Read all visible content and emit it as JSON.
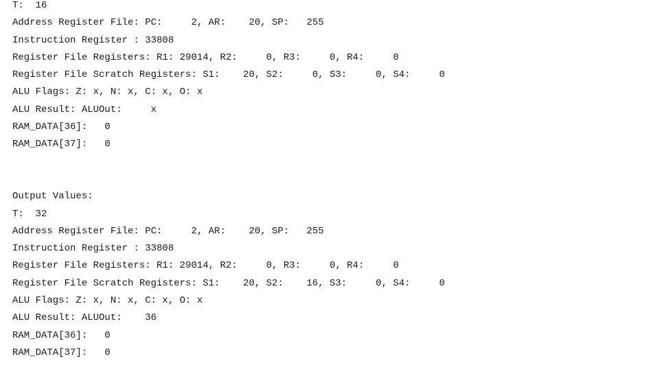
{
  "console": {
    "block1": {
      "lines": [
        "T:  16",
        "Address Register File: PC:     2, AR:    20, SP:   255",
        "Instruction Register : 33808",
        "Register File Registers: R1: 29014, R2:     0, R3:     0, R4:     0",
        "Register File Scratch Registers: S1:    20, S2:     0, S3:     0, S4:     0",
        "ALU Flags: Z: x, N: x, C: x, O: x",
        "ALU Result: ALUOut:     x",
        "RAM_DATA[36]:   0",
        "RAM_DATA[37]:   0"
      ]
    },
    "block2": {
      "header": "Output Values:",
      "lines": [
        "T:  32",
        "Address Register File: PC:     2, AR:    20, SP:   255",
        "Instruction Register : 33808",
        "Register File Registers: R1: 29014, R2:     0, R3:     0, R4:     0",
        "Register File Scratch Registers: S1:    20, S2:    16, S3:     0, S4:     0",
        "ALU Flags: Z: x, N: x, C: x, O: x",
        "ALU Result: ALUOut:    36",
        "RAM_DATA[36]:   0",
        "RAM_DATA[37]:   0"
      ]
    }
  }
}
